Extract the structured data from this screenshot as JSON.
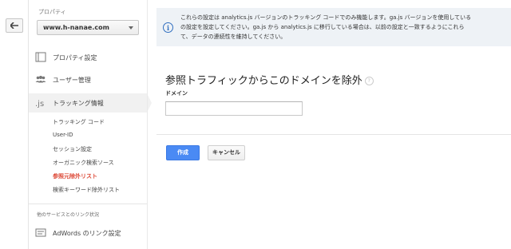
{
  "sidebar": {
    "property_label": "プロパティ",
    "property_value": "www.h-nanae.com",
    "items": [
      {
        "label": "プロパティ設定",
        "icon": "property-settings-icon"
      },
      {
        "label": "ユーザー管理",
        "icon": "users-icon"
      },
      {
        "label": "トラッキング情報",
        "icon": "js-icon"
      }
    ],
    "tracking_sub_items": [
      "トラッキング コード",
      "User-ID",
      "セッション設定",
      "オーガニック検索ソース",
      "参照元除外リスト",
      "検索キーワード除外リスト"
    ],
    "selected_sub_item": "参照元除外リスト",
    "linked_section_label": "他のサービスとのリンク状況",
    "adwords_label": "AdWords のリンク設定"
  },
  "notice": {
    "line1": "これらの設定は analytics.js バージョンのトラッキング コードでのみ機能します。ga.js バージョンを使用している",
    "line2": "の設定を設定してください。ga.js から analytics.js に移行している場合は、以前の設定と一致するようにこれら",
    "line3": "て、データの連続性を維持してください。"
  },
  "main": {
    "title": "参照トラフィックからこのドメインを除外",
    "domain_label": "ドメイン",
    "domain_value": "",
    "create_button": "作成",
    "cancel_button": "キャンセル"
  },
  "colors": {
    "accent_blue": "#4a8af4",
    "selected_red": "#dd4b39",
    "notice_bg": "#eef2f6"
  }
}
